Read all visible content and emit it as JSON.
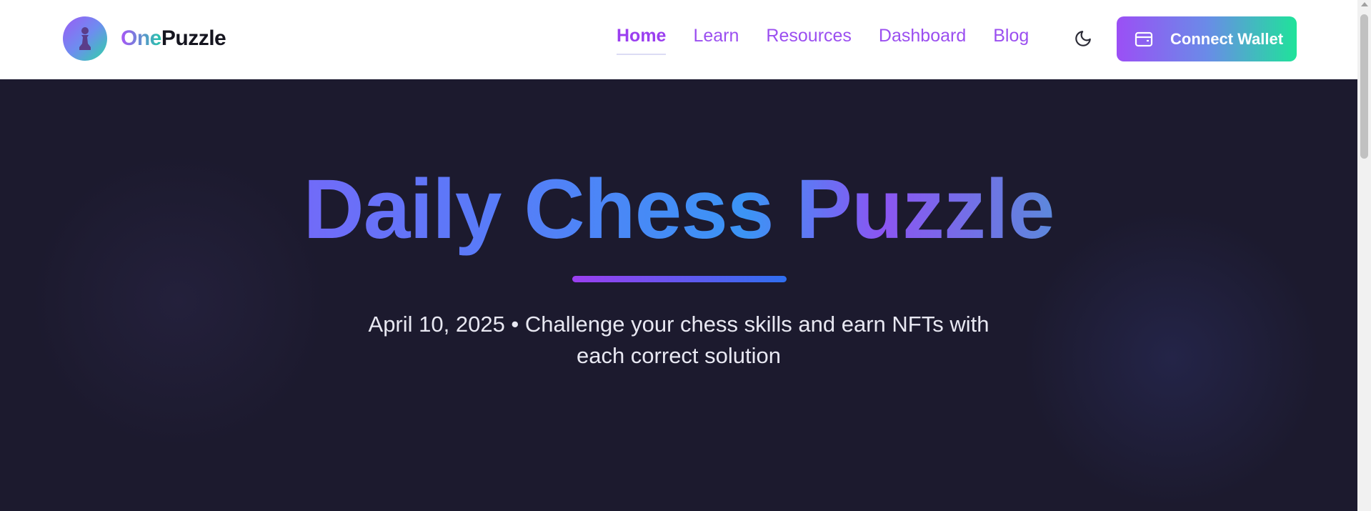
{
  "brand": {
    "name_part1": "One",
    "name_part2": "Puzzle",
    "logo_icon": "chess-pawn-icon"
  },
  "nav": {
    "links": [
      {
        "label": "Home",
        "active": true
      },
      {
        "label": "Learn",
        "active": false
      },
      {
        "label": "Resources",
        "active": false
      },
      {
        "label": "Dashboard",
        "active": false
      },
      {
        "label": "Blog",
        "active": false
      }
    ],
    "theme_toggle_icon": "moon-icon",
    "wallet_button": {
      "label": "Connect Wallet",
      "icon": "wallet-icon"
    }
  },
  "hero": {
    "title": "Daily Chess Puzzle",
    "subtitle_line1": "April 10, 2025 • Challenge your chess skills and earn NFTs with",
    "subtitle_line2": "each correct solution"
  },
  "colors": {
    "accent_purple": "#9b4ff5",
    "accent_green": "#1fe39a",
    "hero_background": "#1c1a2e"
  }
}
